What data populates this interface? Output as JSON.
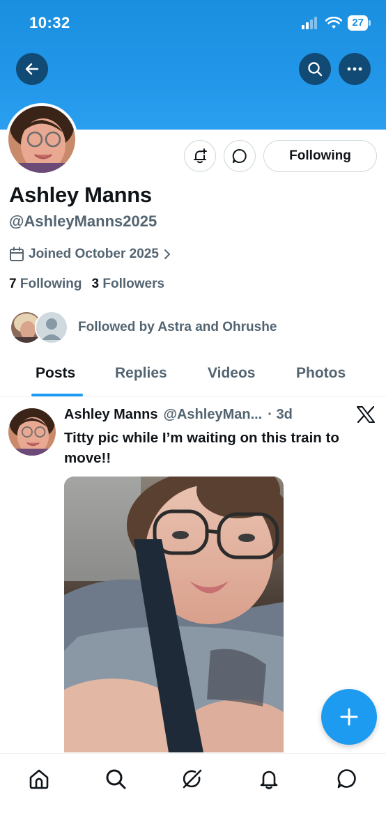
{
  "status_bar": {
    "time": "10:32",
    "battery": "27",
    "icons": [
      "signal-icon",
      "wifi-icon",
      "battery-icon"
    ]
  },
  "header": {
    "back_icon": "back-arrow-icon",
    "search_icon": "search-icon",
    "more_icon": "more-icon"
  },
  "profile": {
    "display_name": "Ashley Manns",
    "handle": "@AshleyManns2025",
    "joined": "Joined October 2025",
    "following_count": "7",
    "following_label": "Following",
    "followers_count": "3",
    "followers_label": "Followers",
    "followed_by": "Followed by Astra and Ohrushe",
    "follow_button_label": "Following",
    "notify_icon": "bell-plus-icon",
    "message_icon": "message-icon"
  },
  "tabs": [
    {
      "label": "Posts",
      "active": true
    },
    {
      "label": "Replies",
      "active": false
    },
    {
      "label": "Videos",
      "active": false
    },
    {
      "label": "Photos",
      "active": false
    }
  ],
  "post": {
    "name": "Ashley Manns",
    "handle": "@AshleyMan...",
    "time": "· 3d",
    "text": "Titty pic while I’m waiting on this train to move!!"
  },
  "fab_icon": "plus-icon",
  "bottom_nav": [
    "home-icon",
    "search-icon",
    "grok-icon",
    "bell-icon",
    "messages-icon"
  ],
  "colors": {
    "accent": "#1d9bf0",
    "banner": "#1a8fdf",
    "muted": "#536471"
  }
}
